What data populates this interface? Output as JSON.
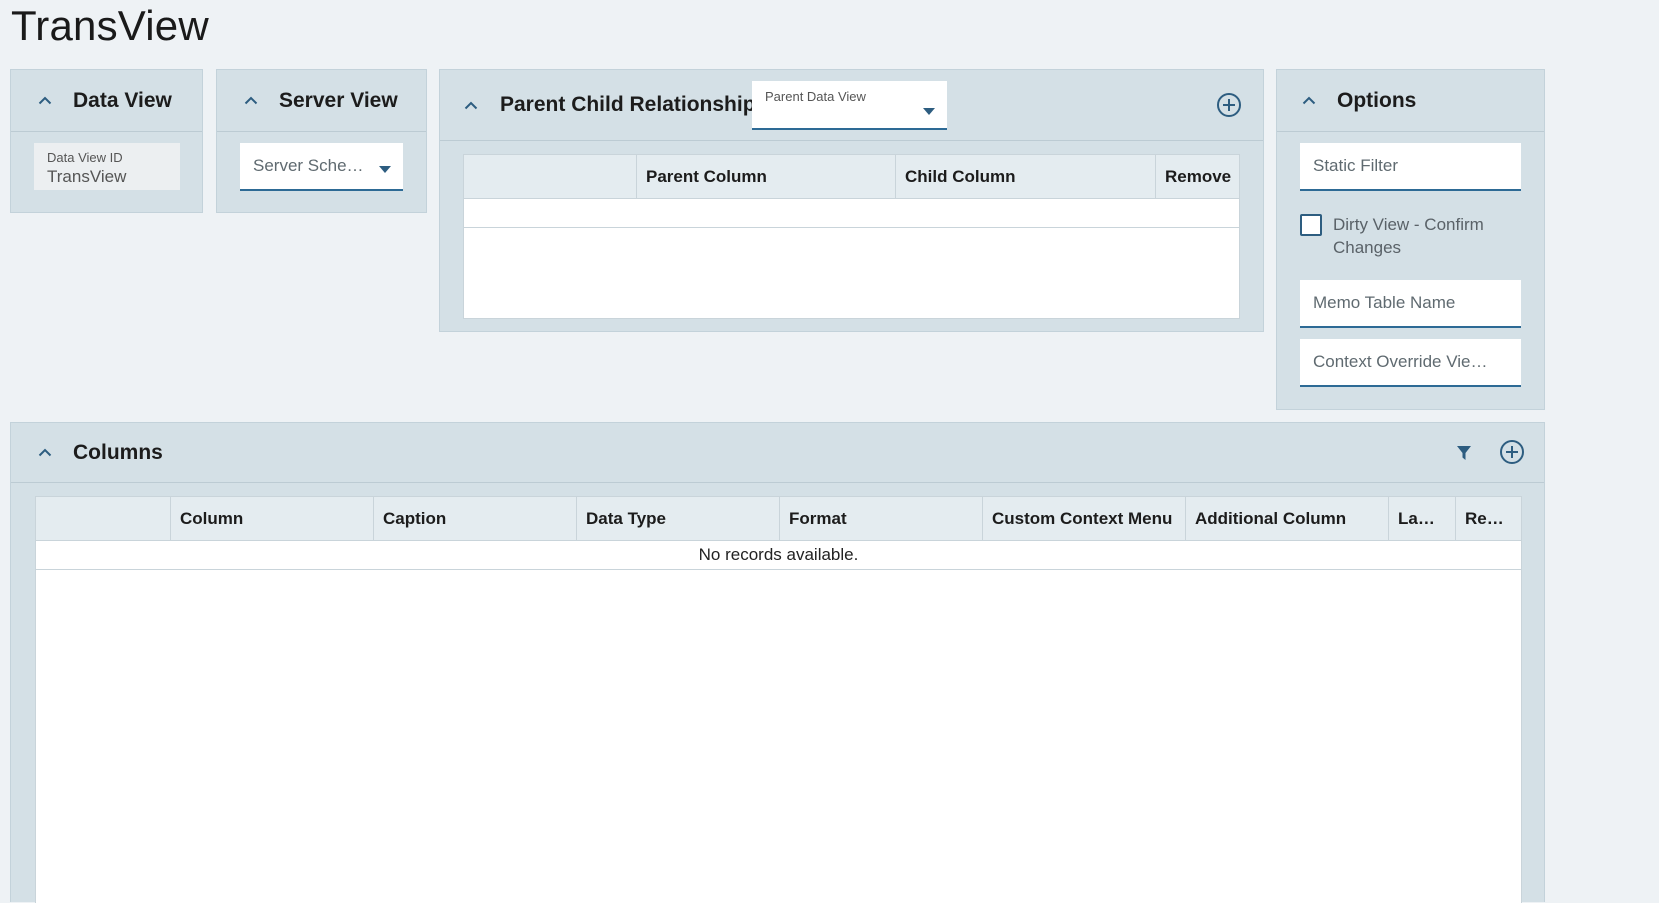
{
  "page": {
    "title": "TransView"
  },
  "data_view": {
    "title": "Data View",
    "id_label": "Data View ID",
    "id_value": "TransView"
  },
  "server_view": {
    "title": "Server View",
    "schema_placeholder": "Server Sche…"
  },
  "parent_child": {
    "title": "Parent Child Relationships",
    "parent_data_view_label": "Parent Data View",
    "columns": [
      "",
      "Parent Column",
      "Child Column",
      "Remove"
    ]
  },
  "options": {
    "title": "Options",
    "static_filter_placeholder": "Static Filter",
    "dirty_view_label_line1": "Dirty View - Confirm",
    "dirty_view_label_line2": "Changes",
    "dirty_view_checked": false,
    "memo_table_placeholder": "Memo Table Name",
    "context_override_placeholder": "Context Override Vie…"
  },
  "columns_panel": {
    "title": "Columns",
    "columns": [
      "",
      "Column",
      "Caption",
      "Data Type",
      "Format",
      "Custom Context Menu",
      "Additional Column",
      "La…",
      "Re…"
    ],
    "empty_message": "No records available."
  },
  "icons": {
    "collapse": "chevron-up-icon",
    "add": "plus-circle-icon",
    "filter": "filter-icon",
    "dropdown": "caret-down-icon"
  },
  "colors": {
    "accent": "#2d6a95",
    "panel_bg": "#d4e0e6",
    "page_bg": "#eef2f5"
  }
}
